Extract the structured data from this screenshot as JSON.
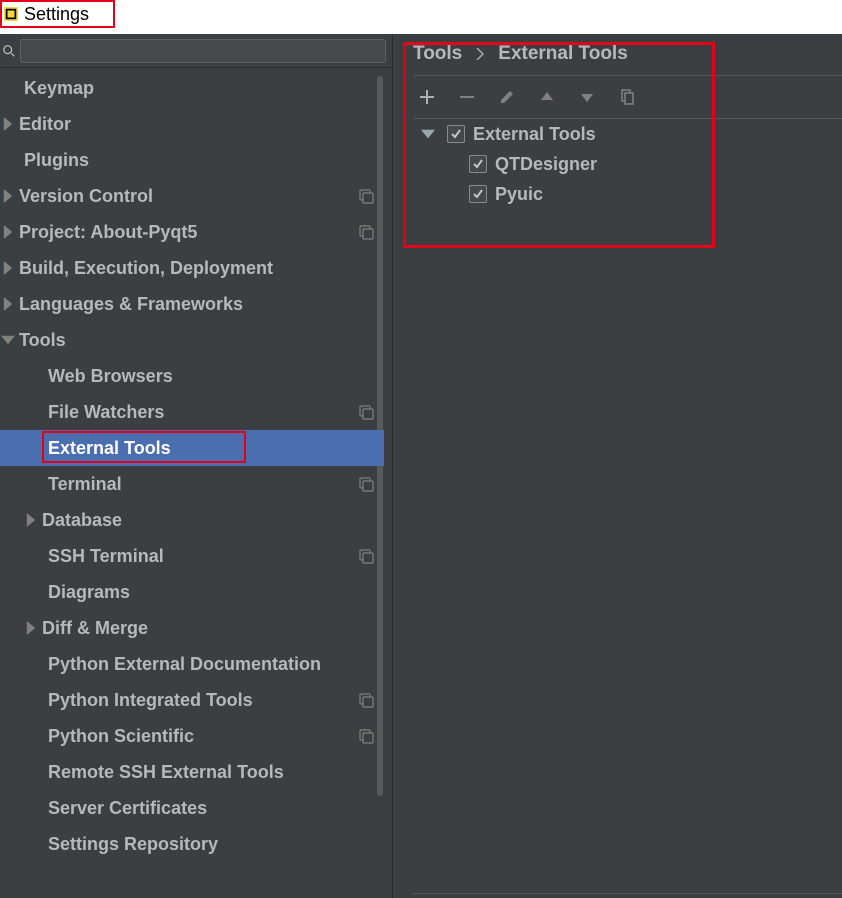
{
  "titlebar": {
    "title": "Settings"
  },
  "search": {
    "placeholder": ""
  },
  "sidebar": {
    "items": [
      {
        "label": "Keymap",
        "level": 1,
        "arrow": false,
        "scope": false
      },
      {
        "label": "Editor",
        "level": 0,
        "arrow": true,
        "arrowDown": false,
        "scope": false
      },
      {
        "label": "Plugins",
        "level": 1,
        "arrow": false,
        "scope": false
      },
      {
        "label": "Version Control",
        "level": 0,
        "arrow": true,
        "arrowDown": false,
        "scope": true
      },
      {
        "label": "Project: About-Pyqt5",
        "level": 0,
        "arrow": true,
        "arrowDown": false,
        "scope": true
      },
      {
        "label": "Build, Execution, Deployment",
        "level": 0,
        "arrow": true,
        "arrowDown": false,
        "scope": false
      },
      {
        "label": "Languages & Frameworks",
        "level": 0,
        "arrow": true,
        "arrowDown": false,
        "scope": false
      },
      {
        "label": "Tools",
        "level": 0,
        "arrow": true,
        "arrowDown": true,
        "scope": false
      },
      {
        "label": "Web Browsers",
        "level": 2,
        "arrow": false,
        "scope": false
      },
      {
        "label": "File Watchers",
        "level": 2,
        "arrow": false,
        "scope": true
      },
      {
        "label": "External Tools",
        "level": 2,
        "arrow": false,
        "scope": false,
        "selected": true,
        "highlight": true
      },
      {
        "label": "Terminal",
        "level": 2,
        "arrow": false,
        "scope": true
      },
      {
        "label": "Database",
        "level": 2,
        "arrow": true,
        "arrowDown": false,
        "scope": false
      },
      {
        "label": "SSH Terminal",
        "level": 2,
        "arrow": false,
        "scope": true
      },
      {
        "label": "Diagrams",
        "level": 2,
        "arrow": false,
        "scope": false
      },
      {
        "label": "Diff & Merge",
        "level": 2,
        "arrow": true,
        "arrowDown": false,
        "scope": false
      },
      {
        "label": "Python External Documentation",
        "level": 2,
        "arrow": false,
        "scope": false
      },
      {
        "label": "Python Integrated Tools",
        "level": 2,
        "arrow": false,
        "scope": true
      },
      {
        "label": "Python Scientific",
        "level": 2,
        "arrow": false,
        "scope": true
      },
      {
        "label": "Remote SSH External Tools",
        "level": 2,
        "arrow": false,
        "scope": false
      },
      {
        "label": "Server Certificates",
        "level": 2,
        "arrow": false,
        "scope": false
      },
      {
        "label": "Settings Repository",
        "level": 2,
        "arrow": false,
        "scope": false
      }
    ]
  },
  "breadcrumb": {
    "root": "Tools",
    "leaf": "External Tools"
  },
  "right_tree": {
    "group": {
      "label": "External Tools",
      "checked": true,
      "items": [
        {
          "label": "QTDesigner",
          "checked": true
        },
        {
          "label": "Pyuic",
          "checked": true
        }
      ]
    }
  }
}
